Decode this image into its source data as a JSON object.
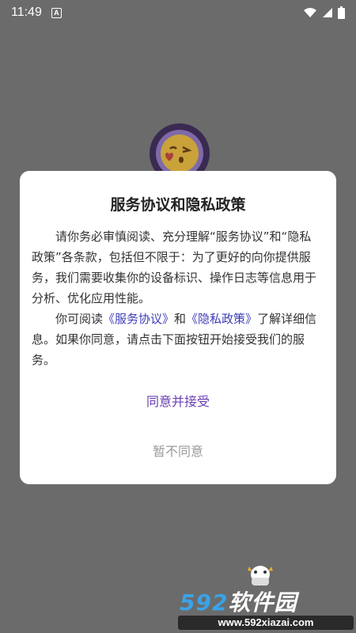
{
  "status_bar": {
    "time": "11:49",
    "notification_letter": "A",
    "icons": [
      "wifi-icon",
      "signal-icon",
      "battery-icon"
    ]
  },
  "background_app": {
    "logo": "emoji-kiss-icon"
  },
  "dialog": {
    "title": "服务协议和隐私政策",
    "paragraph1": "请你务必审慎阅读、充分理解“服务协议”和“隐私政策”各条款，包括但不限于：为了更好的向你提供服务，我们需要收集你的设备标识、操作日志等信息用于分析、优化应用性能。",
    "paragraph2_prefix": "你可阅读",
    "service_link": "《服务协议》",
    "and_text": "和",
    "privacy_link": "《隐私政策》",
    "paragraph2_suffix": "了解详细信息。如果你同意，请点击下面按钮开始接受我们的服务。",
    "agree_label": "同意并接受",
    "disagree_label": "暂不同意"
  },
  "watermark": {
    "brand_number": "592",
    "brand_text": "软件园",
    "url": "www.592xiazai.com"
  },
  "colors": {
    "overlay": "#6b6b6b",
    "accent": "#6a3fb5",
    "link": "#3d3db8",
    "muted": "#9a9a9a"
  }
}
